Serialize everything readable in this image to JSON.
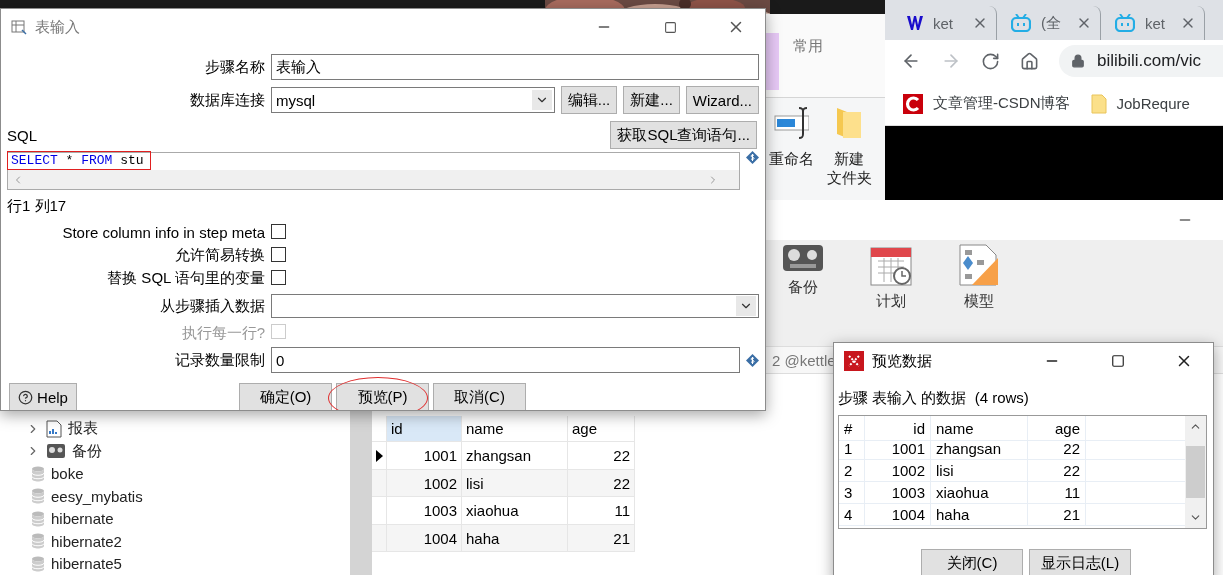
{
  "browser": {
    "tabs": [
      {
        "label": "ket",
        "kind": "w",
        "selected": false
      },
      {
        "label": "(全",
        "kind": "tv",
        "selected": false
      },
      {
        "label": "ket",
        "kind": "tv",
        "selected": false
      }
    ],
    "address": "bilibili.com/vic",
    "bookmarks": [
      {
        "label": "文章管理-CSDN博客",
        "kind": "csdn"
      },
      {
        "label": "JobRequre",
        "kind": "folder"
      }
    ]
  },
  "explorer": {
    "tab": "常用",
    "actions": [
      {
        "lines": [
          "重命名"
        ],
        "kind": "rename"
      },
      {
        "lines": [
          "新建",
          "文件夹"
        ],
        "kind": "folder"
      }
    ]
  },
  "navicat": {
    "tools": [
      {
        "label": "备份",
        "kind": "backup"
      },
      {
        "label": "计划",
        "kind": "schedule"
      },
      {
        "label": "模型",
        "kind": "model"
      }
    ],
    "connection": "2 @kettle",
    "tree": [
      {
        "label": "报表",
        "kind": "report"
      },
      {
        "label": "备份",
        "kind": "backup"
      },
      {
        "label": "boke",
        "kind": "database"
      },
      {
        "label": "eesy_mybatis",
        "kind": "database"
      },
      {
        "label": "hibernate",
        "kind": "database"
      },
      {
        "label": "hibernate2",
        "kind": "database"
      },
      {
        "label": "hibernate5",
        "kind": "database"
      }
    ],
    "grid": {
      "columns": [
        {
          "label": "id",
          "selected": true
        },
        {
          "label": "name",
          "selected": false
        },
        {
          "label": "age",
          "selected": false
        }
      ],
      "rows": [
        {
          "cells": [
            "1001",
            "zhangsan",
            "22"
          ],
          "selected": true
        },
        {
          "cells": [
            "1002",
            "lisi",
            "22"
          ],
          "selected": false
        },
        {
          "cells": [
            "1003",
            "xiaohua",
            "11"
          ],
          "selected": false
        },
        {
          "cells": [
            "1004",
            "haha",
            "21"
          ],
          "selected": false
        }
      ]
    }
  },
  "step_dialog": {
    "title": "表输入",
    "step_name": {
      "label": "步骤名称",
      "value": "表输入"
    },
    "connection": {
      "label": "数据库连接",
      "value": "mysql",
      "buttons": [
        "编辑...",
        "新建...",
        "Wizard..."
      ]
    },
    "sql_label": "SQL",
    "get_sql_button": "获取SQL查询语句...",
    "sql": [
      {
        "text": "SELECT",
        "kind": "keyword"
      },
      {
        "text": " * ",
        "kind": "plain"
      },
      {
        "text": "FROM",
        "kind": "keyword"
      },
      {
        "text": " stu",
        "kind": "plain"
      }
    ],
    "cursor": "行1 列17",
    "options": [
      {
        "label": "Store column info in step meta",
        "checked": false,
        "disabled": false
      },
      {
        "label": "允许简易转换",
        "checked": false,
        "disabled": false
      },
      {
        "label": "替换 SQL 语句里的变量",
        "checked": false,
        "disabled": false
      }
    ],
    "insert_from": {
      "label": "从步骤插入数据"
    },
    "execute_each": {
      "label": "执行每一行?",
      "checked": false,
      "disabled": true
    },
    "limit": {
      "label": "记录数量限制",
      "value": "0"
    },
    "help": "Help",
    "buttons": [
      {
        "label": "确定(O)",
        "circled": false
      },
      {
        "label": "预览(P)",
        "circled": true
      },
      {
        "label": "取消(C)",
        "circled": false
      }
    ]
  },
  "preview_dialog": {
    "title": "预览数据",
    "caption": "步骤 表输入 的数据  (4 rows)",
    "columns": [
      "#",
      "id",
      "name",
      "age"
    ],
    "rows": [
      [
        "1",
        "1001",
        "zhangsan",
        "22"
      ],
      [
        "2",
        "1002",
        "lisi",
        "22"
      ],
      [
        "3",
        "1003",
        "xiaohua",
        "11"
      ],
      [
        "4",
        "1004",
        "haha",
        "21"
      ]
    ],
    "buttons": [
      "关闭(C)",
      "显示日志(L)"
    ]
  }
}
